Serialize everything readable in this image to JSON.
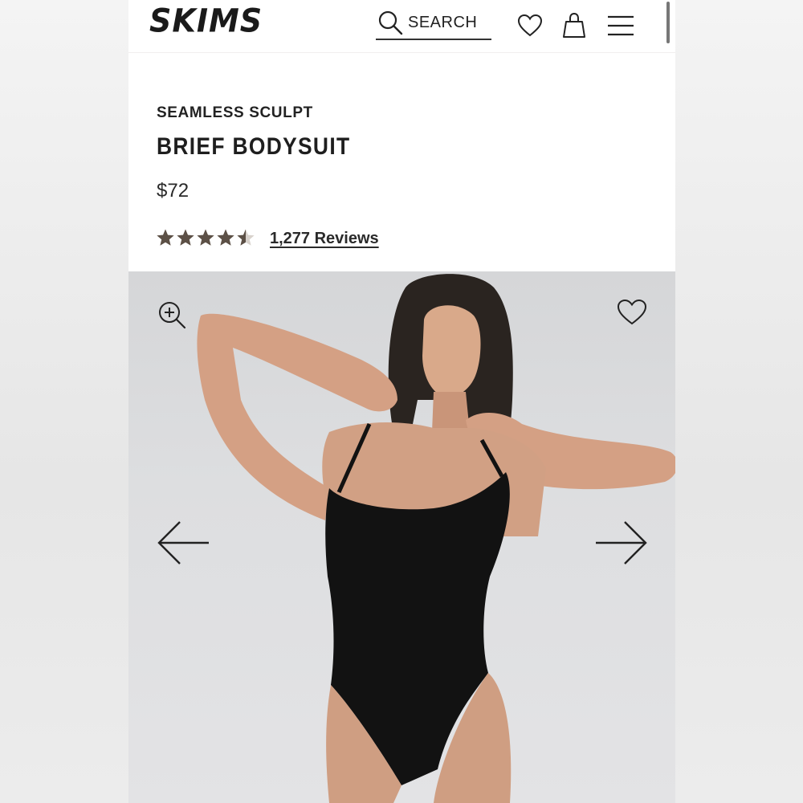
{
  "header": {
    "logo": "SKIMS",
    "search_label": "SEARCH",
    "icons": [
      "search-icon",
      "heart-icon",
      "shopping-bag-icon",
      "menu-icon"
    ]
  },
  "product": {
    "collection": "SEAMLESS SCULPT",
    "title": "BRIEF BODYSUIT",
    "price": "$72",
    "rating": 4.5,
    "rating_max": 5,
    "reviews_label": "1,277 Reviews",
    "star_color": "#5c5046"
  },
  "gallery": {
    "icons": [
      "zoom-in-icon",
      "heart-icon",
      "arrow-left-icon",
      "arrow-right-icon"
    ]
  }
}
